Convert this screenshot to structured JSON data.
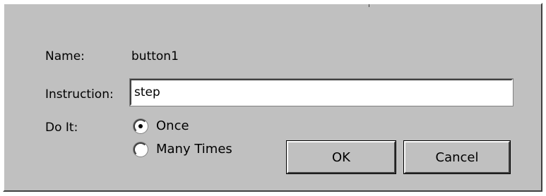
{
  "dialog": {
    "name_label": "Name:",
    "name_value": "button1",
    "instruction_label": "Instruction:",
    "instruction_value": "step",
    "doit_label": "Do It:",
    "options": [
      {
        "label": "Once",
        "selected": true
      },
      {
        "label": "Many Times",
        "selected": false
      }
    ],
    "ok_label": "OK",
    "cancel_label": "Cancel"
  },
  "colors": {
    "dialog_background": "#c0c0c0",
    "field_background": "#ffffff",
    "text": "#000000"
  }
}
